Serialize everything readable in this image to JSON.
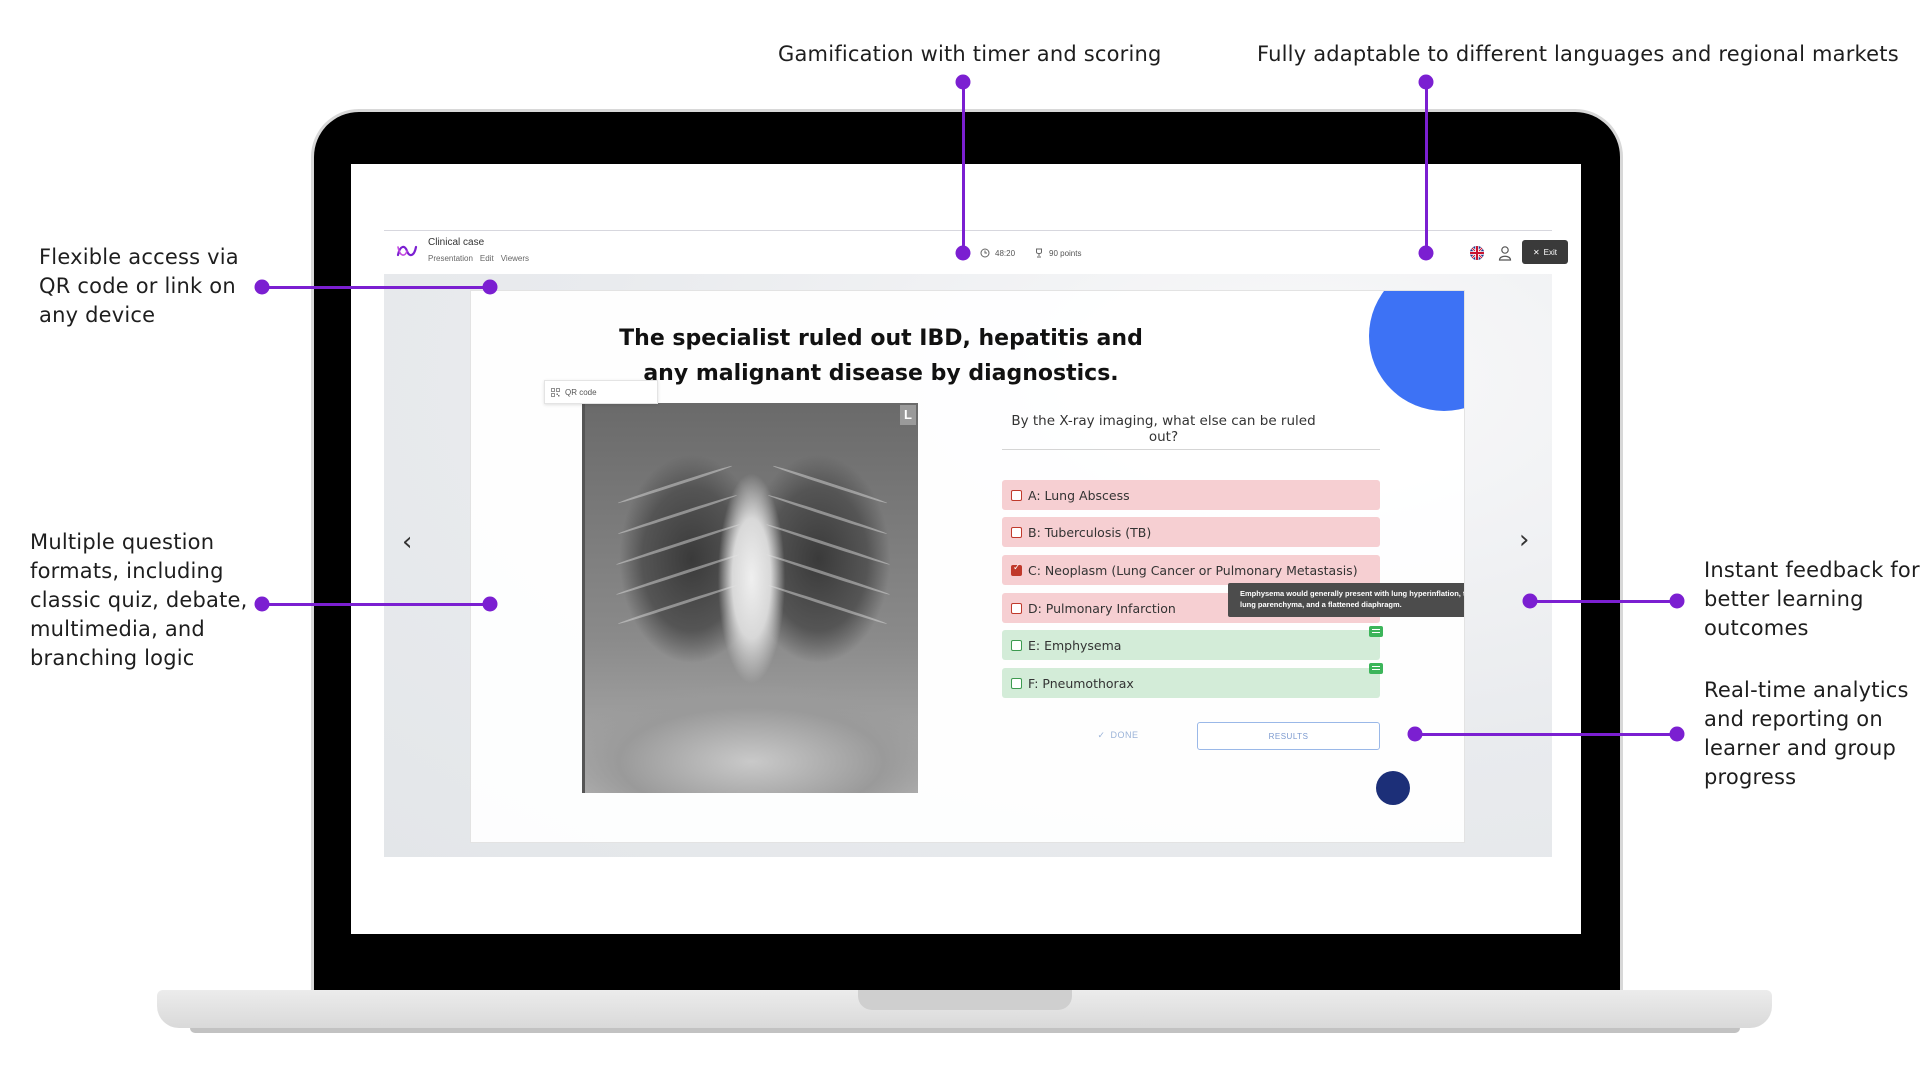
{
  "callouts": {
    "gamification": "Gamification with timer and scoring",
    "languages": "Fully adaptable to different languages and regional markets",
    "access": [
      "Flexible access via",
      "QR code or link on",
      "any device"
    ],
    "formats": [
      "Multiple question",
      "formats, including",
      "classic quiz, debate,",
      "multimedia, and",
      "branching logic"
    ],
    "feedback": [
      "Instant feedback for",
      "better learning",
      "outcomes"
    ],
    "analytics": [
      "Real-time analytics",
      "and reporting on",
      "learner and group",
      "progress"
    ]
  },
  "header": {
    "case_title": "Clinical case",
    "menu": [
      "Presentation",
      "Edit",
      "Viewers"
    ],
    "timer": "48:20",
    "points": "90 points",
    "exit_label": "Exit",
    "qr_label": "QR code"
  },
  "slide": {
    "headline": "The specialist ruled out IBD, hepatitis and any malignant disease by diagnostics.",
    "xray_marker": "L",
    "question": "By the X-ray imaging, what else can be ruled out?",
    "options": [
      {
        "label": "A: Lung Abscess",
        "state": "wrong"
      },
      {
        "label": "B: Tuberculosis (TB)",
        "state": "wrong"
      },
      {
        "label": "C: Neoplasm (Lung Cancer or Pulmonary Metastasis)",
        "state": "wrong",
        "checked": true
      },
      {
        "label": "D: Pulmonary Infarction",
        "state": "wrong"
      },
      {
        "label": "E: Emphysema",
        "state": "correct"
      },
      {
        "label": "F: Pneumothorax",
        "state": "correct"
      }
    ],
    "tooltip": "Emphysema would generally present with lung hyperinflation, thinning of lung parenchyma, and a flattened diaphragm.",
    "done_label": "DONE",
    "results_label": "RESULTS"
  },
  "colors": {
    "accent": "#7b1fd1",
    "wrong_bg": "#f6cfd2",
    "correct_bg": "#d3ecd8",
    "blue_shape": "#3d72f5",
    "navy_shape": "#1c2f78"
  },
  "icons": [
    "logo-icon",
    "clock-icon",
    "trophy-icon",
    "uk-flag-icon",
    "user-icon",
    "close-icon",
    "qr-icon",
    "chevron-left-icon",
    "chevron-right-icon",
    "comment-icon",
    "check-icon"
  ]
}
